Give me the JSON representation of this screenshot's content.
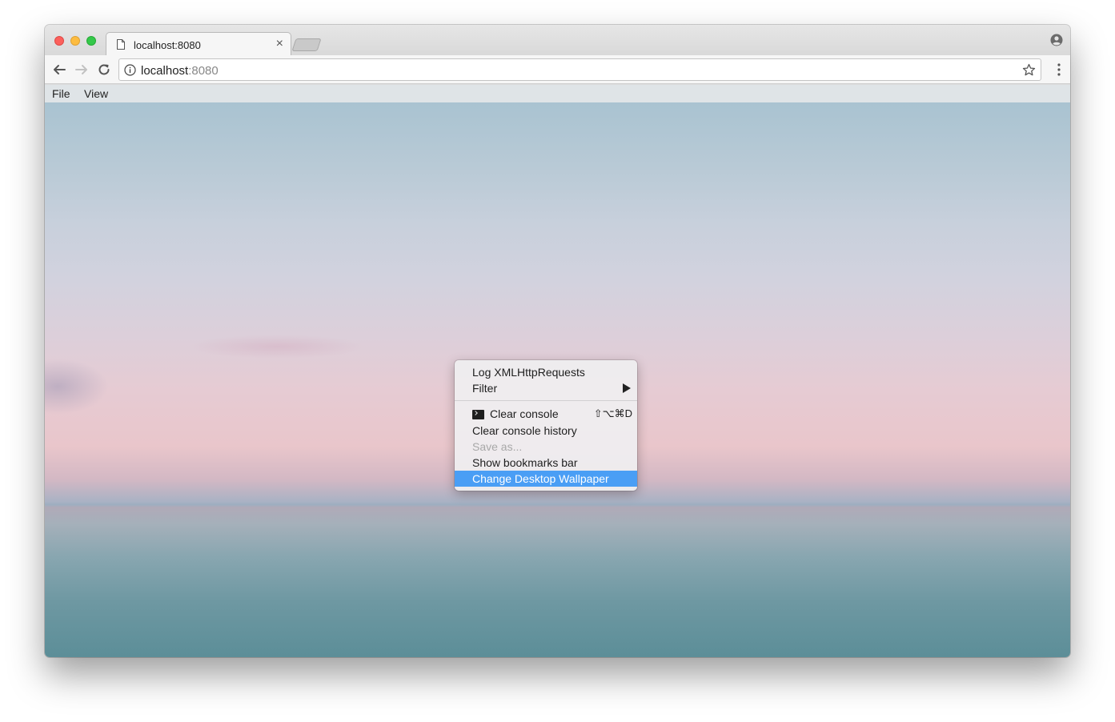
{
  "browser": {
    "tab": {
      "title": "localhost:8080",
      "close_symbol": "×"
    },
    "address_bar": {
      "host": "localhost",
      "port": ":8080"
    },
    "colors": {
      "traffic_red": "#fc605c",
      "traffic_yellow": "#fdbc40",
      "traffic_green": "#34c84a"
    }
  },
  "menubar": {
    "file": "File",
    "view": "View"
  },
  "context_menu": {
    "items": [
      {
        "label": "Log XMLHttpRequests"
      },
      {
        "label": "Filter",
        "submenu": true
      },
      {
        "label": "Clear console",
        "shortcut": "⇧⌥⌘D",
        "icon": "terminal-icon"
      },
      {
        "label": "Clear console history"
      },
      {
        "label": "Save as...",
        "disabled": true
      },
      {
        "label": "Show bookmarks bar"
      },
      {
        "label": "Change Desktop Wallpaper",
        "highlighted": true
      }
    ],
    "highlight_color": "#4a9ef5"
  }
}
